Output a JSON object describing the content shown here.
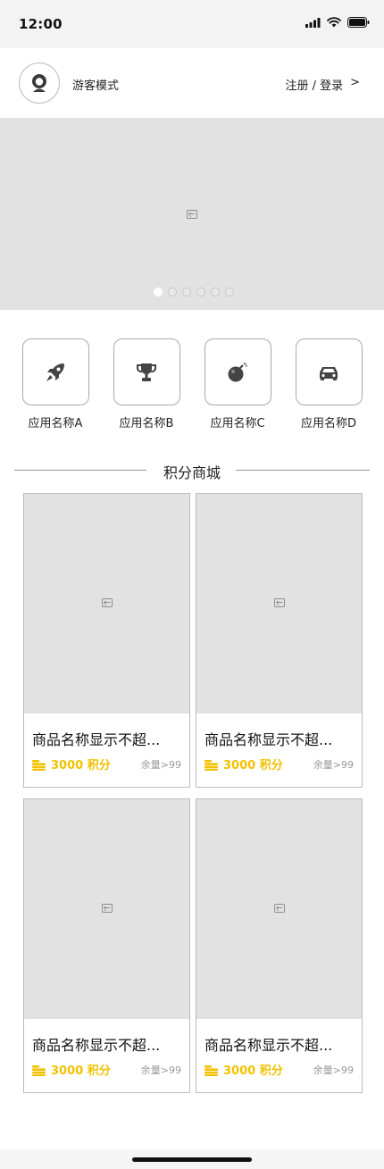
{
  "status_bar": {
    "time": "12:00"
  },
  "header": {
    "guest_label": "游客模式",
    "login_link": "注册 / 登录",
    "login_arrow": ">"
  },
  "banner": {
    "page_count": 6,
    "active_page": 1
  },
  "apps": [
    {
      "label": "应用名称A",
      "icon": "rocket-icon"
    },
    {
      "label": "应用名称B",
      "icon": "trophy-icon"
    },
    {
      "label": "应用名称C",
      "icon": "bomb-icon"
    },
    {
      "label": "应用名称D",
      "icon": "car-icon"
    }
  ],
  "mall": {
    "title": "积分商城",
    "products": [
      {
        "name": "商品名称显示不超...",
        "points": "3000 积分",
        "stock": "余量>99"
      },
      {
        "name": "商品名称显示不超...",
        "points": "3000 积分",
        "stock": "余量>99"
      },
      {
        "name": "商品名称显示不超...",
        "points": "3000 积分",
        "stock": "余量>99"
      },
      {
        "name": "商品名称显示不超...",
        "points": "3000 积分",
        "stock": "余量>99"
      }
    ]
  },
  "colors": {
    "accent": "#f2c100",
    "placeholder": "#e2e2e2"
  }
}
